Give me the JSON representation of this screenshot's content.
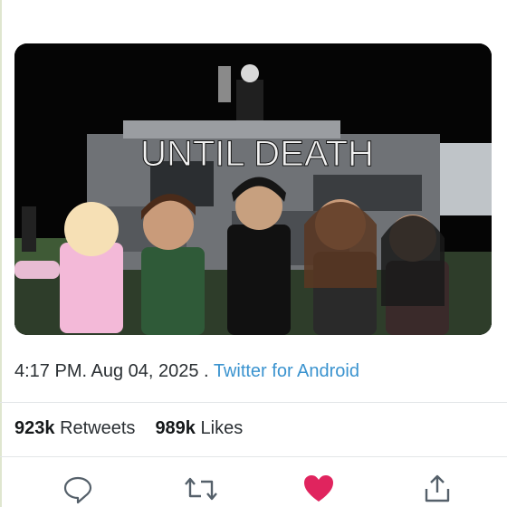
{
  "media": {
    "title_text": "UNTIL DEATH"
  },
  "meta": {
    "time_date": "4:17 PM. Aug 04, 2025",
    "separator": " . ",
    "source": "Twitter for Android"
  },
  "stats": {
    "retweets_count": "923k",
    "retweets_label": "Retweets",
    "likes_count": "989k",
    "likes_label": "Likes"
  },
  "actions": [
    {
      "icon": "reply-icon"
    },
    {
      "icon": "retweet-icon"
    },
    {
      "icon": "like-icon",
      "color": "#e0245e",
      "active": true
    },
    {
      "icon": "share-icon"
    }
  ],
  "colors": {
    "link": "#3a93cf",
    "like": "#e0245e",
    "text": "#2a2f33"
  }
}
